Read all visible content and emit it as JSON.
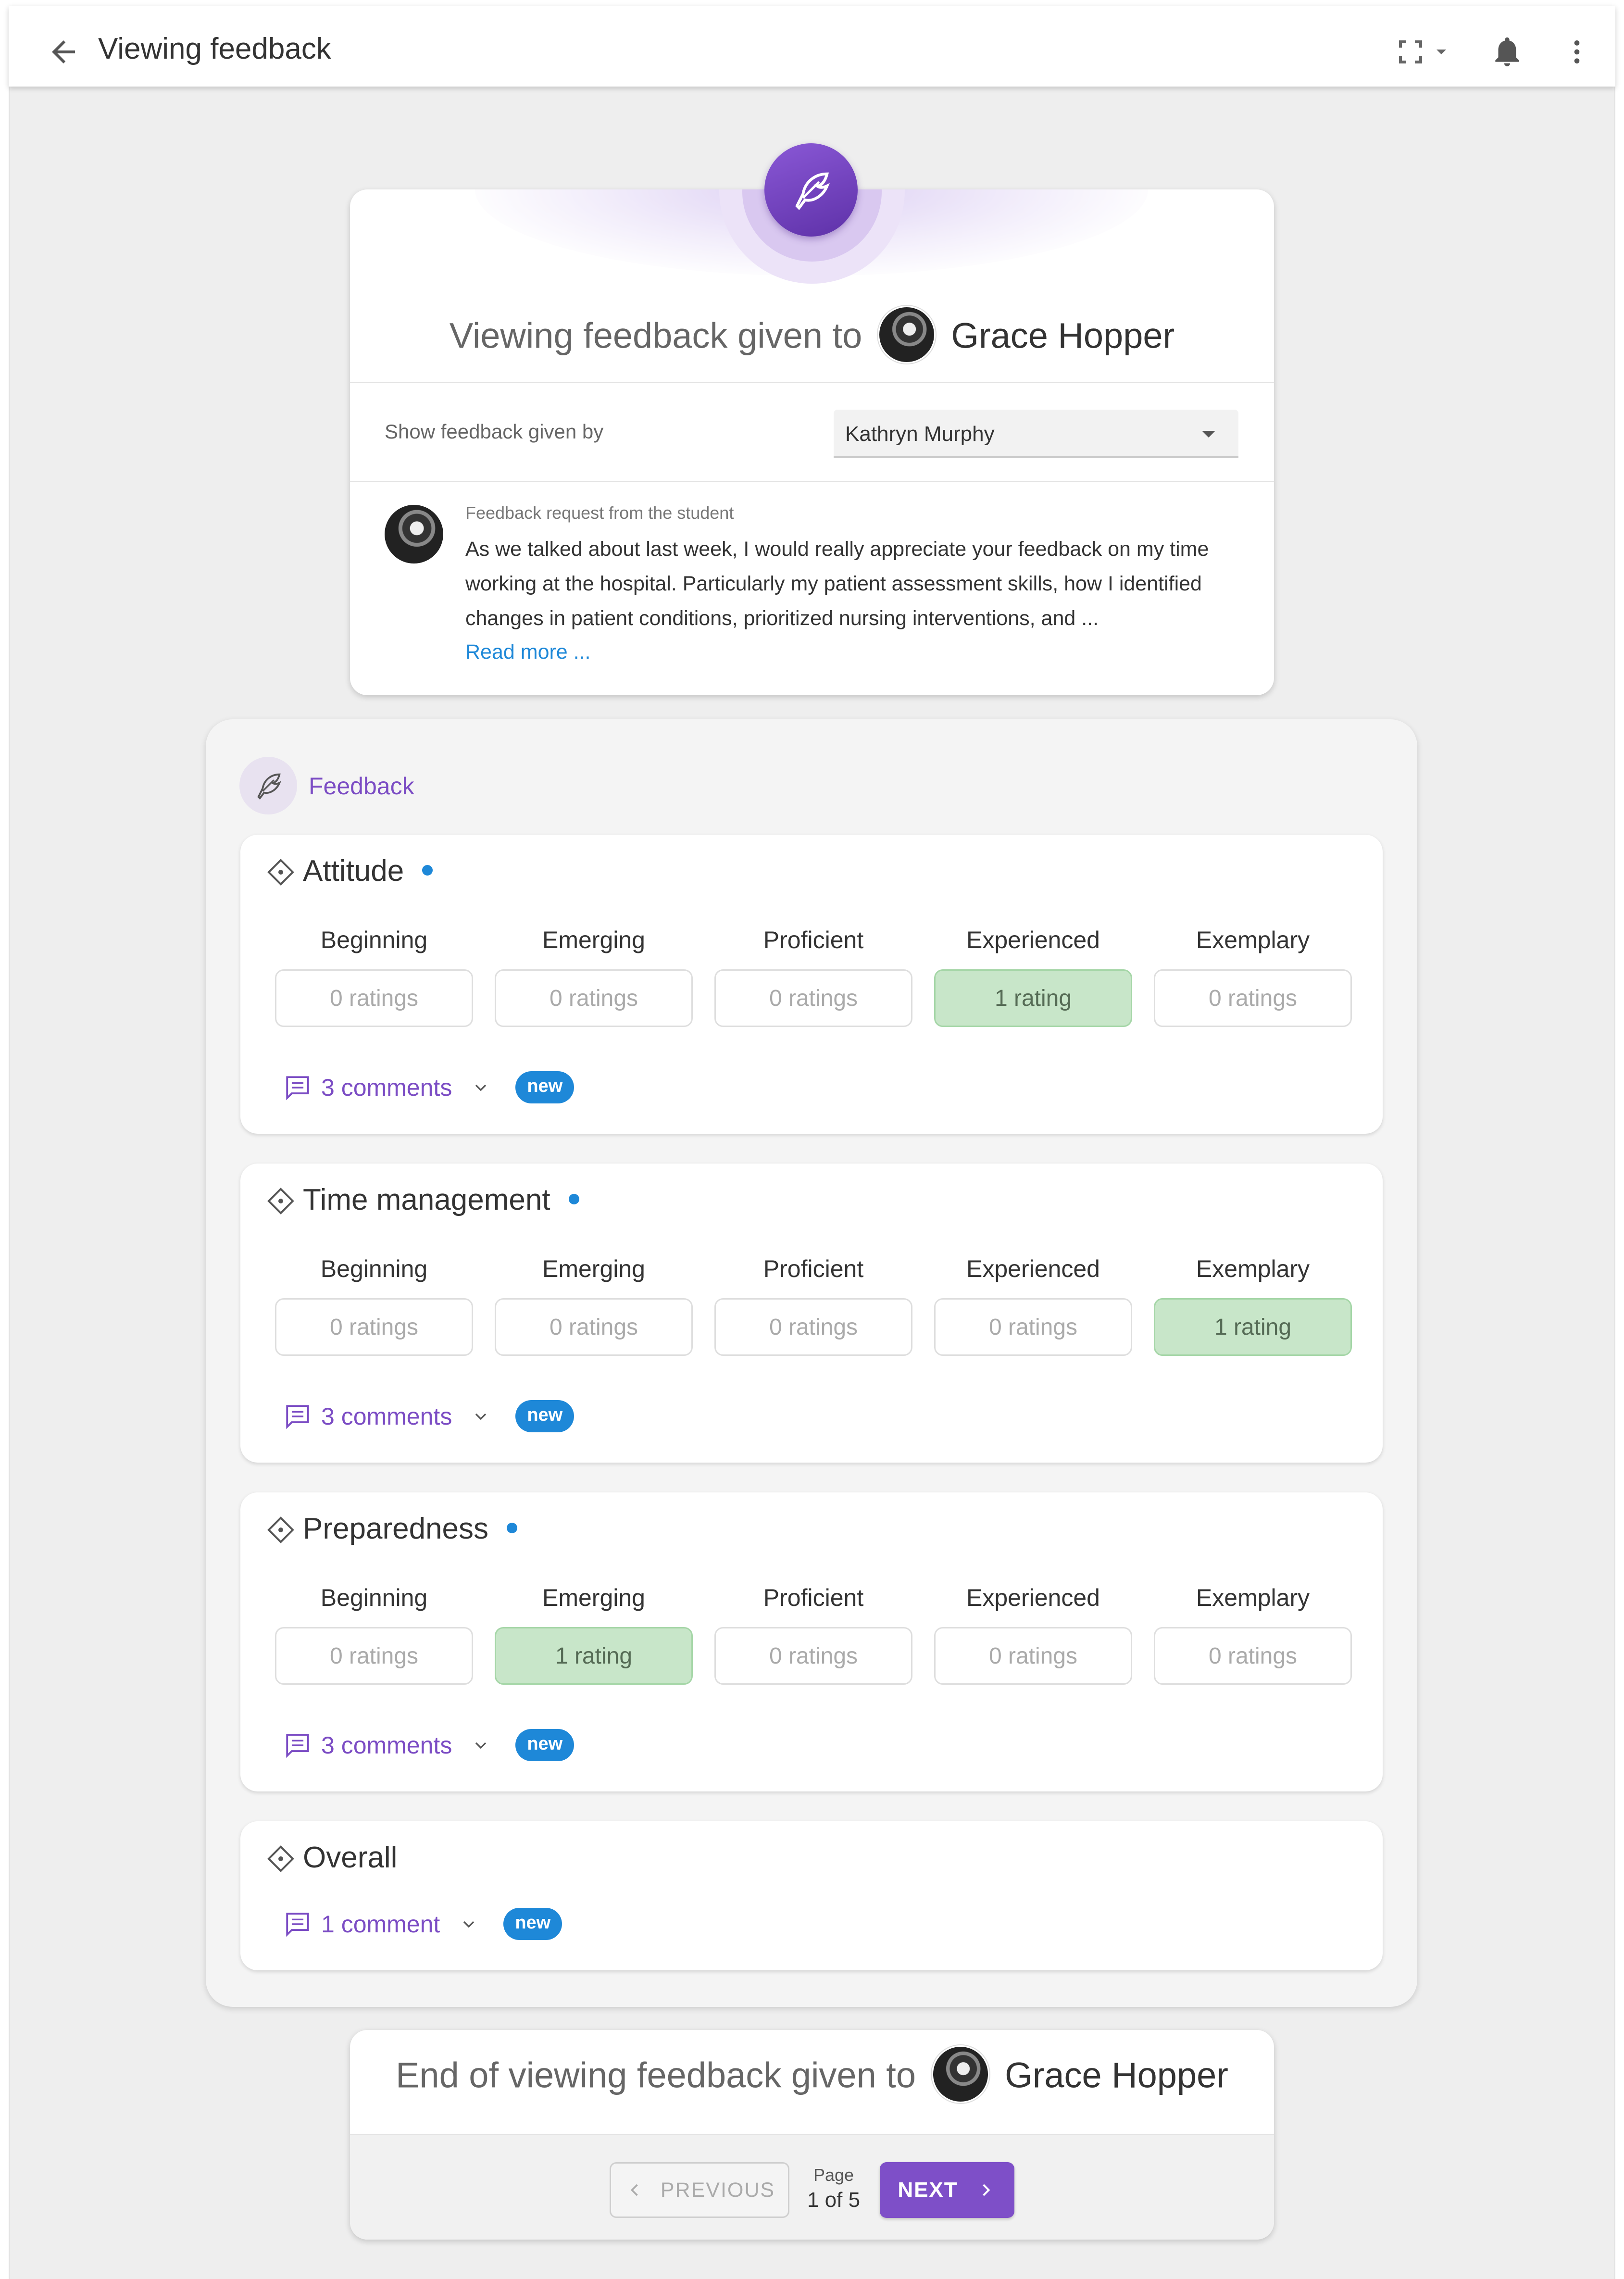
{
  "appbar": {
    "title": "Viewing feedback",
    "icons": [
      "back-arrow-icon",
      "fullscreen-icon",
      "chevron-down-icon",
      "bell-icon",
      "more-vert-icon"
    ]
  },
  "header": {
    "title_prefix": "Viewing feedback given to",
    "student_name": "Grace Hopper",
    "show_label": "Show feedback given by",
    "selected_giver": "Kathryn Murphy",
    "request_title": "Feedback request from the student",
    "request_text": "As we talked about last week, I would really appreciate your feedback on my time working at the hospital. Particularly my patient assessment skills,  how I identified changes in patient conditions, prioritized nursing interventions, and ...",
    "read_more": "Read more ..."
  },
  "feedback": {
    "label": "Feedback",
    "criteria": [
      {
        "title": "Attitude",
        "levels": [
          {
            "name": "Beginning",
            "ratings": "0 ratings",
            "selected": false
          },
          {
            "name": "Emerging",
            "ratings": "0 ratings",
            "selected": false
          },
          {
            "name": "Proficient",
            "ratings": "0 ratings",
            "selected": false
          },
          {
            "name": "Experienced",
            "ratings": "1 rating",
            "selected": true
          },
          {
            "name": "Exemplary",
            "ratings": "0 ratings",
            "selected": false
          }
        ],
        "comments": "3 comments",
        "new_badge": "new"
      },
      {
        "title": "Time management",
        "levels": [
          {
            "name": "Beginning",
            "ratings": "0 ratings",
            "selected": false
          },
          {
            "name": "Emerging",
            "ratings": "0 ratings",
            "selected": false
          },
          {
            "name": "Proficient",
            "ratings": "0 ratings",
            "selected": false
          },
          {
            "name": "Experienced",
            "ratings": "0 ratings",
            "selected": false
          },
          {
            "name": "Exemplary",
            "ratings": "1 rating",
            "selected": true
          }
        ],
        "comments": "3 comments",
        "new_badge": "new"
      },
      {
        "title": "Preparedness",
        "levels": [
          {
            "name": "Beginning",
            "ratings": "0 ratings",
            "selected": false
          },
          {
            "name": "Emerging",
            "ratings": "1 rating",
            "selected": true
          },
          {
            "name": "Proficient",
            "ratings": "0 ratings",
            "selected": false
          },
          {
            "name": "Experienced",
            "ratings": "0 ratings",
            "selected": false
          },
          {
            "name": "Exemplary",
            "ratings": "0 ratings",
            "selected": false
          }
        ],
        "comments": "3 comments",
        "new_badge": "new"
      }
    ],
    "overall": {
      "title": "Overall",
      "comments": "1 comment",
      "new_badge": "new"
    }
  },
  "footer": {
    "title_prefix": "End of viewing feedback given to",
    "student_name": "Grace Hopper",
    "previous_label": "PREVIOUS",
    "page_label": "Page",
    "page_value": "1 of 5",
    "next_label": "NEXT"
  },
  "colors": {
    "accent": "#7b4cc4",
    "link": "#1e88d8",
    "selected_fill": "#c8e6c9",
    "background": "#eeeeee"
  }
}
